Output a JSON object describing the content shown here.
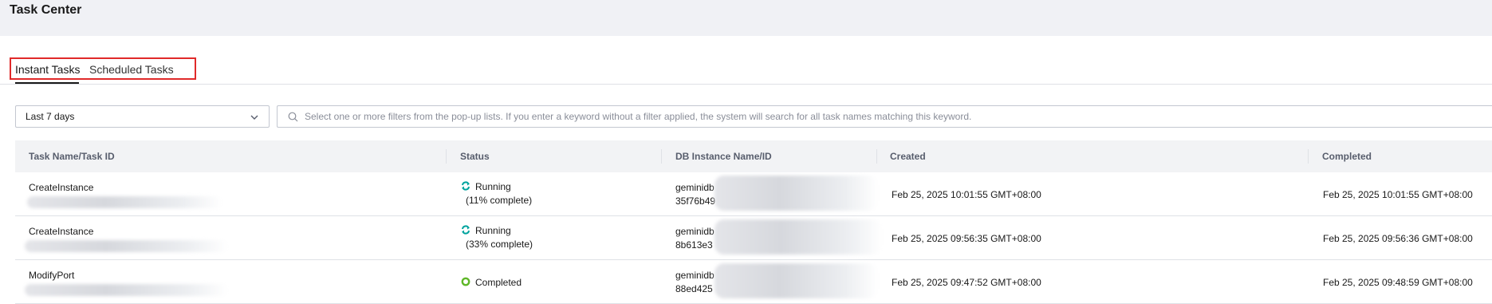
{
  "page": {
    "title": "Task Center"
  },
  "tabs": [
    {
      "label": "Instant Tasks",
      "active": true
    },
    {
      "label": "Scheduled Tasks",
      "active": false
    }
  ],
  "filter": {
    "time_range": "Last 7 days",
    "search_placeholder": "Select one or more filters from the pop-up lists. If you enter a keyword without a filter applied, the system will search for all task names matching this keyword."
  },
  "table": {
    "columns": [
      "Task Name/Task ID",
      "Status",
      "DB Instance Name/ID",
      "Created",
      "Completed"
    ],
    "rows": [
      {
        "task_name": "CreateInstance",
        "status": "Running",
        "status_icon": "sync-icon",
        "progress": "(11% complete)",
        "db_name": "geminidb",
        "db_id": "35f76b49",
        "created": "Feb 25, 2025 10:01:55 GMT+08:00",
        "completed": "Feb 25, 2025 10:01:55 GMT+08:00"
      },
      {
        "task_name": "CreateInstance",
        "status": "Running",
        "status_icon": "sync-icon",
        "progress": "(33% complete)",
        "db_name": "geminidb",
        "db_id": "8b613e3",
        "created": "Feb 25, 2025 09:56:35 GMT+08:00",
        "completed": "Feb 25, 2025 09:56:36 GMT+08:00"
      },
      {
        "task_name": "ModifyPort",
        "status": "Completed",
        "status_icon": "completed-circle-icon",
        "db_name": "geminidb",
        "db_id": "88ed425",
        "created": "Feb 25, 2025 09:47:52 GMT+08:00",
        "completed": "Feb 25, 2025 09:48:59 GMT+08:00"
      }
    ]
  },
  "colors": {
    "running": "#00a39e",
    "completed": "#5fb728",
    "tab_highlight": "#e02a2a"
  }
}
